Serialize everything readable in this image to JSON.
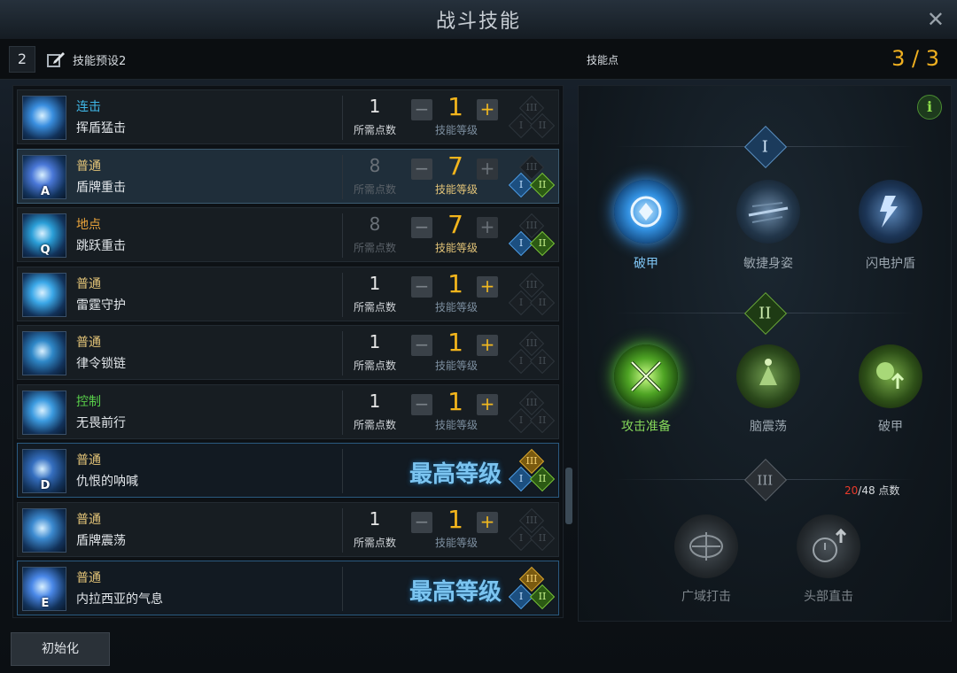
{
  "window": {
    "title": "战斗技能",
    "close_icon": "close-icon"
  },
  "preset": {
    "number": "2",
    "name": "技能预设2",
    "skill_points_label": "技能点",
    "skill_points_value": "3 / 3"
  },
  "labels": {
    "cost": "所需点数",
    "level": "技能等级",
    "max_level": "最高等级"
  },
  "skills": [
    {
      "type": "连击",
      "type_color": "#3fb6e6",
      "name": "挥盾猛击",
      "key": "",
      "cost": "1",
      "level": "1",
      "tripods": {
        "t": "off",
        "l": "off",
        "r": "off"
      }
    },
    {
      "type": "普通",
      "type_color": "#e3c478",
      "name": "盾牌重击",
      "key": "A",
      "cost": "8",
      "level": "7",
      "tripods": {
        "t": "off",
        "l": "on",
        "r": "on"
      }
    },
    {
      "type": "地点",
      "type_color": "#e8a23a",
      "name": "跳跃重击",
      "key": "Q",
      "cost": "8",
      "level": "7",
      "tripods": {
        "t": "off",
        "l": "on",
        "r": "on"
      }
    },
    {
      "type": "普通",
      "type_color": "#e3c478",
      "name": "雷霆守护",
      "key": "",
      "cost": "1",
      "level": "1",
      "tripods": {
        "t": "off",
        "l": "off",
        "r": "off"
      }
    },
    {
      "type": "普通",
      "type_color": "#e3c478",
      "name": "律令锁链",
      "key": "",
      "cost": "1",
      "level": "1",
      "tripods": {
        "t": "off",
        "l": "off",
        "r": "off"
      }
    },
    {
      "type": "控制",
      "type_color": "#59d04a",
      "name": "无畏前行",
      "key": "",
      "cost": "1",
      "level": "1",
      "tripods": {
        "t": "off",
        "l": "off",
        "r": "off"
      }
    },
    {
      "type": "普通",
      "type_color": "#e3c478",
      "name": "仇恨的呐喊",
      "key": "D",
      "max": true,
      "tripods": {
        "t": "on",
        "l": "on",
        "r": "on"
      }
    },
    {
      "type": "普通",
      "type_color": "#e3c478",
      "name": "盾牌震荡",
      "key": "",
      "cost": "1",
      "level": "1",
      "tripods": {
        "t": "off",
        "l": "off",
        "r": "off"
      }
    },
    {
      "type": "普通",
      "type_color": "#e3c478",
      "name": "内拉西亚的气息",
      "key": "E",
      "max": true,
      "tripods": {
        "t": "on",
        "l": "on",
        "r": "on"
      }
    }
  ],
  "reset_button": "初始化",
  "tripod_panel": {
    "tier1": {
      "numeral": "I",
      "options": [
        "破甲",
        "敏捷身姿",
        "闪电护盾"
      ]
    },
    "tier2": {
      "numeral": "II",
      "options": [
        "攻击准备",
        "脑震荡",
        "破甲"
      ]
    },
    "tier3": {
      "numeral": "III",
      "options": [
        "广域打击",
        "头部直击"
      ]
    },
    "points_current": "20",
    "points_text": "/48 点数"
  }
}
